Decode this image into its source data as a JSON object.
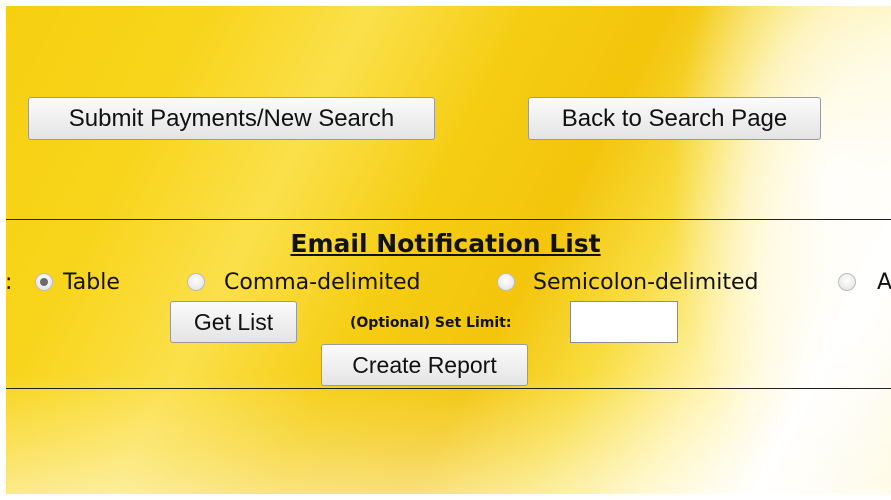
{
  "buttons": {
    "submit_payments": "Submit Payments/New Search",
    "back_to_search": "Back to Search Page",
    "get_list": "Get List",
    "create_report": "Create Report"
  },
  "email_section": {
    "title": "Email Notification List",
    "format_prefix": ":",
    "formats": [
      {
        "label": "Table",
        "selected": true
      },
      {
        "label": "Comma-delimited",
        "selected": false
      },
      {
        "label": "Semicolon-delimited",
        "selected": false
      },
      {
        "label": "A",
        "selected": false
      }
    ],
    "limit_label": "(Optional) Set Limit:",
    "limit_value": ""
  }
}
